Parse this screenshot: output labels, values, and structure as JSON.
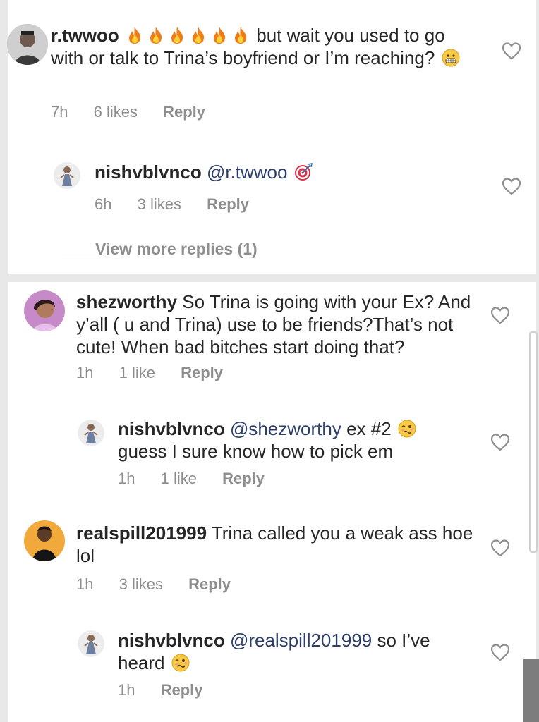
{
  "comments": [
    {
      "username": "r.twwoo",
      "text_after_emoji": "but wait you used to go with or talk to Trina’s boyfriend or I’m reaching?",
      "time": "7h",
      "likes": "6 likes",
      "reply": "Reply",
      "icons": [
        "fire-emoji",
        "grimacing-emoji"
      ]
    },
    {
      "username": "nishvblvnco",
      "mention": "@r.twwoo",
      "time": "6h",
      "likes": "3 likes",
      "reply": "Reply",
      "icons": [
        "dart-target-emoji"
      ]
    },
    {
      "username": "shezworthy",
      "text": "So Trina is going with your Ex? And y’all ( u and Trina) use to be friends?That’s not cute! When bad bitches start doing that?",
      "time": "1h",
      "likes": "1 like",
      "reply": "Reply"
    },
    {
      "username": "nishvblvnco",
      "mention": "@shezworthy",
      "text": "ex #2",
      "text2": "guess I sure know how to pick em",
      "time": "1h",
      "likes": "1 like",
      "reply": "Reply",
      "icons": [
        "woozy-emoji"
      ]
    },
    {
      "username": "realspill201999",
      "text": "Trina called you a weak ass hoe lol",
      "time": "1h",
      "likes": "3 likes",
      "reply": "Reply"
    },
    {
      "username": "nishvblvnco",
      "mention": "@realspill201999",
      "text": "so I’ve",
      "text2": "heard",
      "time": "1h",
      "reply": "Reply",
      "icons": [
        "woozy-emoji"
      ]
    }
  ],
  "view_more_replies": "View more replies (1)",
  "colors": {
    "text": "#262626",
    "meta": "#8e8e8e",
    "mention": "#2c3f6b",
    "background": "#e8e8e8"
  }
}
